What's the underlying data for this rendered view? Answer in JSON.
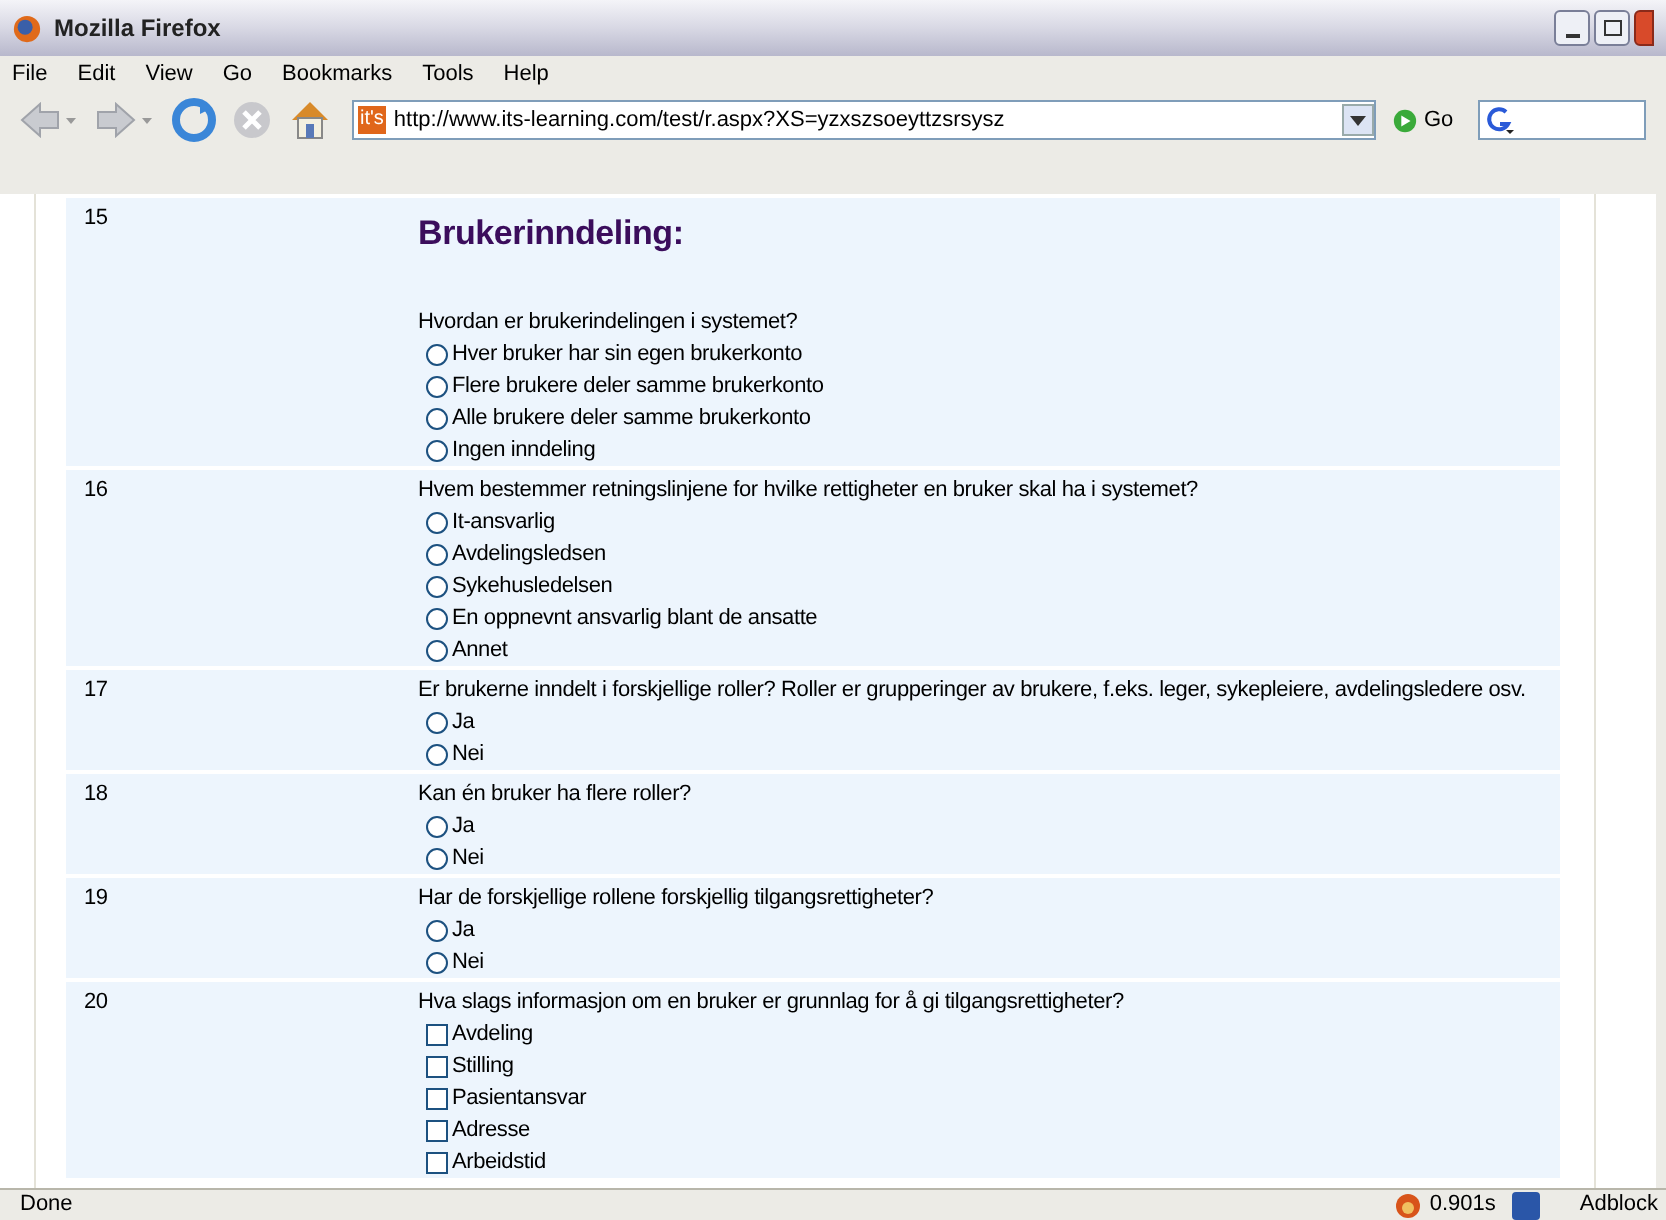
{
  "window": {
    "title": "Mozilla Firefox"
  },
  "menu": [
    "File",
    "Edit",
    "View",
    "Go",
    "Bookmarks",
    "Tools",
    "Help"
  ],
  "address_bar": {
    "value": "http://www.its-learning.com/test/r.aspx?XS=yzxszsoeyttzsrsysz",
    "site_icon": "it's"
  },
  "go_button": "Go",
  "questions": [
    {
      "number": "15",
      "heading": "Brukerinndeling:",
      "text": "Hvordan er brukerindelingen i systemet?",
      "kind": "radio",
      "options": [
        {
          "label": "Hver bruker har sin egen brukerkonto",
          "selected": false
        },
        {
          "label": "Flere brukere deler samme brukerkonto",
          "selected": false
        },
        {
          "label": "Alle brukere deler samme brukerkonto",
          "selected": false
        },
        {
          "label": "Ingen inndeling",
          "selected": false
        }
      ]
    },
    {
      "number": "16",
      "text": "Hvem bestemmer retningslinjene for hvilke rettigheter en bruker skal ha i systemet?",
      "kind": "radio",
      "options": [
        {
          "label": "It-ansvarlig",
          "selected": false
        },
        {
          "label": "Avdelingsledsen",
          "selected": false
        },
        {
          "label": "Sykehusledelsen",
          "selected": false
        },
        {
          "label": "En oppnevnt ansvarlig blant de ansatte",
          "selected": false
        },
        {
          "label": "Annet",
          "selected": false
        }
      ]
    },
    {
      "number": "17",
      "text": "Er brukerne inndelt i forskjellige roller? Roller er grupperinger av brukere, f.eks.  leger, sykepleiere, avdelingsledere osv.",
      "kind": "radio",
      "options": [
        {
          "label": "Ja",
          "selected": false
        },
        {
          "label": "Nei",
          "selected": false
        }
      ]
    },
    {
      "number": "18",
      "text": "Kan én bruker ha flere roller?",
      "kind": "radio",
      "options": [
        {
          "label": "Ja",
          "selected": false
        },
        {
          "label": "Nei",
          "selected": false
        }
      ]
    },
    {
      "number": "19",
      "text": "Har de forskjellige rollene forskjellig tilgangsrettigheter?",
      "kind": "radio",
      "options": [
        {
          "label": "Ja",
          "selected": false
        },
        {
          "label": "Nei",
          "selected": false
        }
      ]
    },
    {
      "number": "20",
      "text": "Hva slags informasjon om en bruker er grunnlag for å gi tilgangsrettigheter?",
      "kind": "checkbox",
      "options": [
        {
          "label": "Avdeling",
          "checked": false
        },
        {
          "label": "Stilling",
          "checked": false
        },
        {
          "label": "Pasientansvar",
          "checked": false
        },
        {
          "label": "Adresse",
          "checked": false
        },
        {
          "label": "Arbeidstid",
          "checked": false
        }
      ]
    }
  ],
  "status_bar": {
    "text": "Done",
    "timing": "0.901s",
    "extension": "Adblock"
  }
}
